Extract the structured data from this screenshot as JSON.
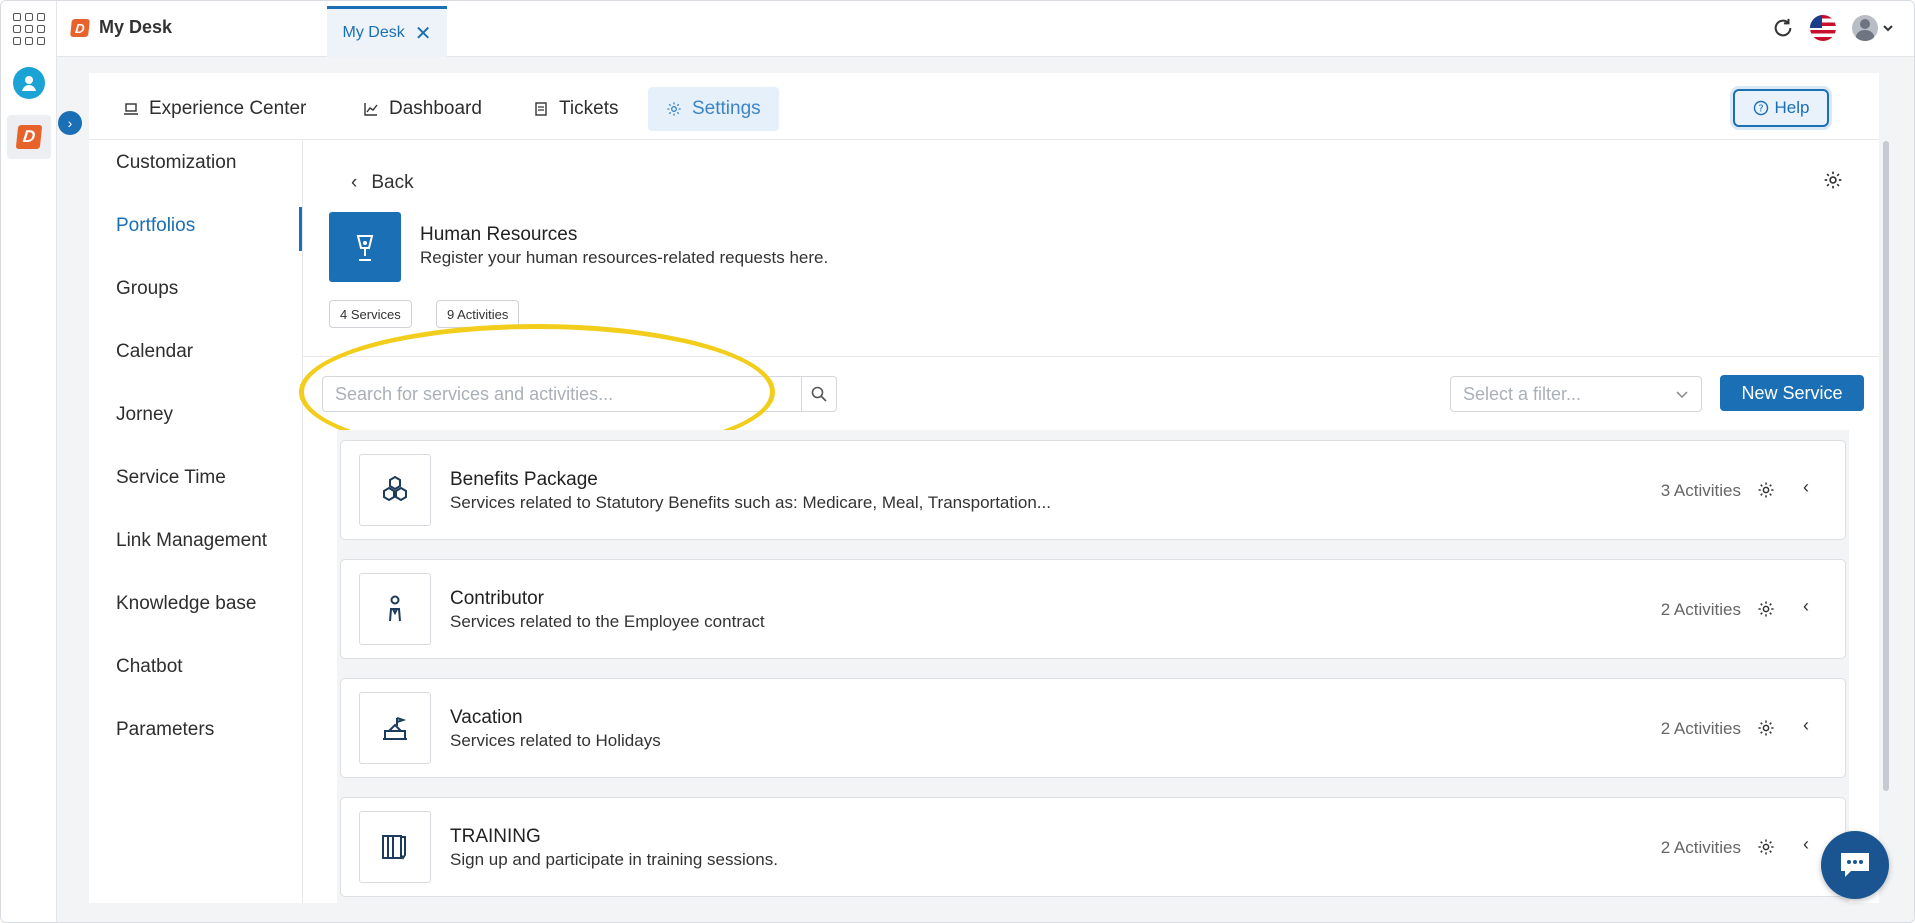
{
  "topbar": {
    "app_title": "My Desk",
    "tab_label": "My Desk"
  },
  "nav": {
    "items": [
      {
        "label": "Experience Center",
        "icon": "laptop-icon"
      },
      {
        "label": "Dashboard",
        "icon": "chart-icon"
      },
      {
        "label": "Tickets",
        "icon": "ticket-icon"
      },
      {
        "label": "Settings",
        "icon": "gear-icon",
        "active": true
      }
    ],
    "help_label": "Help"
  },
  "sidebar": {
    "items": [
      {
        "label": "Customization"
      },
      {
        "label": "Portfolios",
        "active": true
      },
      {
        "label": "Groups"
      },
      {
        "label": "Calendar"
      },
      {
        "label": "Jorney"
      },
      {
        "label": "Service Time"
      },
      {
        "label": "Link Management"
      },
      {
        "label": "Knowledge base"
      },
      {
        "label": "Chatbot"
      },
      {
        "label": "Parameters"
      }
    ]
  },
  "portfolio": {
    "back_label": "Back",
    "title": "Human Resources",
    "description": "Register your human resources-related requests here.",
    "services_chip": "4 Services",
    "activities_chip": "9 Activities"
  },
  "toolbar": {
    "search_placeholder": "Search for services and activities...",
    "filter_placeholder": "Select a filter...",
    "new_service_label": "New Service"
  },
  "services": [
    {
      "title": "Benefits Package",
      "description": "Services related to Statutory Benefits such as: Medicare, Meal, Transportation...",
      "activities": "3 Activities",
      "icon": "hexagons-icon"
    },
    {
      "title": "Contributor",
      "description": "Services related to the Employee contract",
      "activities": "2 Activities",
      "icon": "person-icon"
    },
    {
      "title": "Vacation",
      "description": "Services related to Holidays",
      "activities": "2 Activities",
      "icon": "beach-icon"
    },
    {
      "title": "TRAINING",
      "description": "Sign up and participate in training sessions.",
      "activities": "2 Activities",
      "icon": "book-icon"
    }
  ],
  "colors": {
    "accent": "#1a6fb5",
    "highlight": "#f3cd1c",
    "brand_logo": "#e8622c"
  }
}
